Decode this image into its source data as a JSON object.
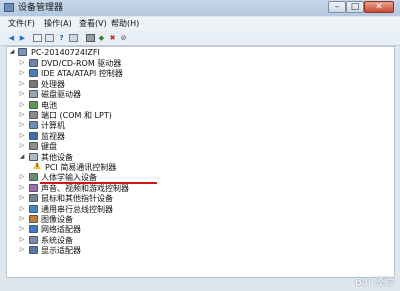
{
  "window": {
    "title": "设备管理器"
  },
  "menu": {
    "file": "文件(F)",
    "action": "操作(A)",
    "view": "查看(V)",
    "help": "帮助(H)"
  },
  "tree": {
    "computer": "PC-20140724IZFI",
    "items": [
      {
        "label": "DVD/CD-ROM 驱动器",
        "icon": "dvd-drive-icon"
      },
      {
        "label": "IDE ATA/ATAPI 控制器",
        "icon": "ide-controller-icon"
      },
      {
        "label": "处理器",
        "icon": "processor-icon"
      },
      {
        "label": "磁盘驱动器",
        "icon": "disk-drive-icon"
      },
      {
        "label": "电池",
        "icon": "battery-icon"
      },
      {
        "label": "端口 (COM 和 LPT)",
        "icon": "port-icon"
      },
      {
        "label": "计算机",
        "icon": "computer-icon"
      },
      {
        "label": "监视器",
        "icon": "monitor-icon"
      },
      {
        "label": "键盘",
        "icon": "keyboard-icon"
      },
      {
        "label": "其他设备",
        "icon": "other-devices-icon",
        "expanded": true
      },
      {
        "label": "PCI 简易通讯控制器",
        "icon": "warning-device-icon",
        "child": true
      },
      {
        "label": "人体学输入设备",
        "icon": "hid-icon"
      },
      {
        "label": "声音、视频和游戏控制器",
        "icon": "sound-icon"
      },
      {
        "label": "鼠标和其他指针设备",
        "icon": "mouse-icon"
      },
      {
        "label": "通用串行总线控制器",
        "icon": "usb-icon"
      },
      {
        "label": "图像设备",
        "icon": "imaging-icon"
      },
      {
        "label": "网络适配器",
        "icon": "network-adapter-icon"
      },
      {
        "label": "系统设备",
        "icon": "system-device-icon"
      },
      {
        "label": "显示适配器",
        "icon": "display-adapter-icon"
      }
    ]
  },
  "watermark": "Bai 经验",
  "colors": {
    "highlight_underline": "#d21414",
    "warning": "#f1c232"
  }
}
